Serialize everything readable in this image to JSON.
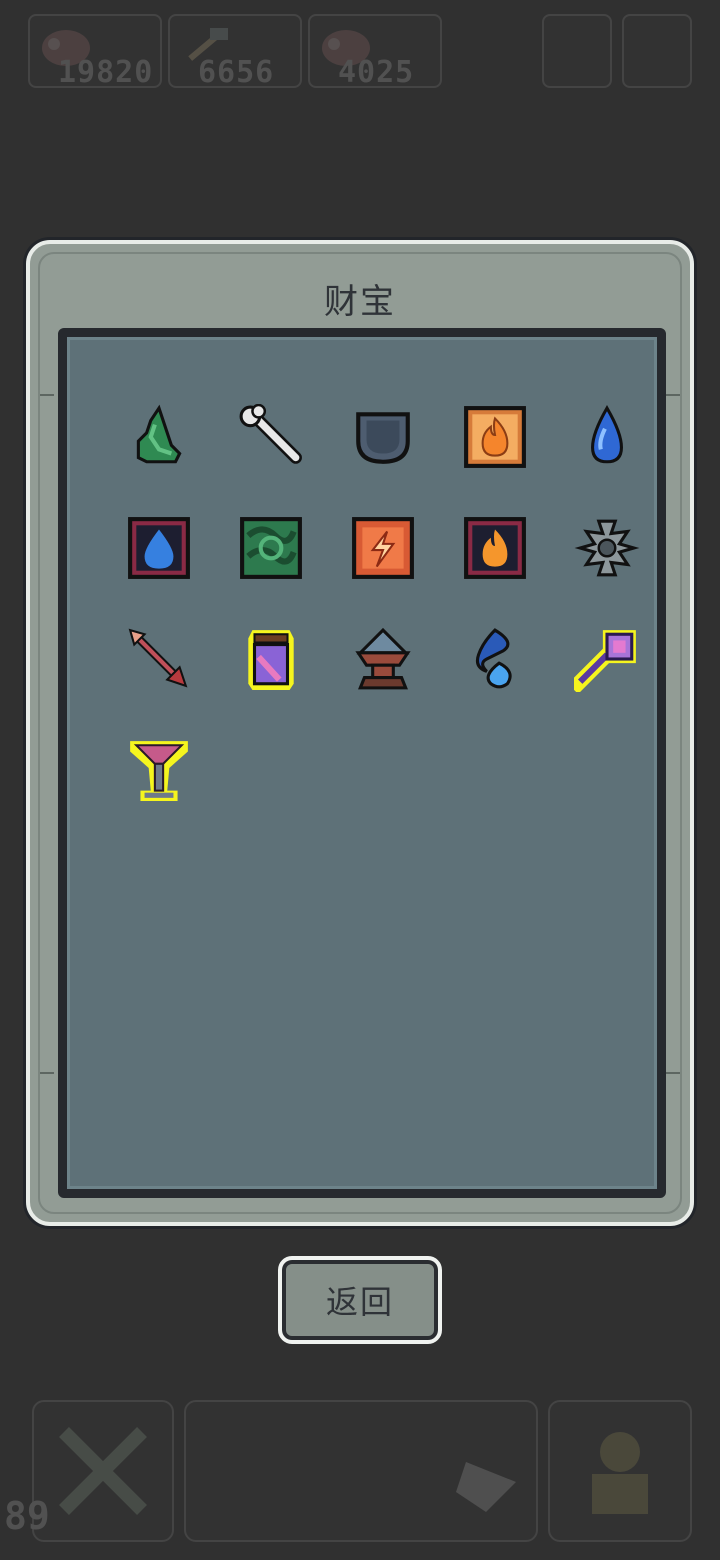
{
  "hud": {
    "resources": [
      {
        "icon": "meat-icon",
        "value": "19820"
      },
      {
        "icon": "hammer-icon",
        "value": "6656"
      },
      {
        "icon": "meat-icon",
        "value": "4025"
      }
    ],
    "level": "89"
  },
  "dialog": {
    "title": "财宝",
    "back_label": "返回",
    "items": [
      {
        "icon": "green-leaf-icon",
        "highlighted": false
      },
      {
        "icon": "bone-icon",
        "highlighted": false
      },
      {
        "icon": "pouch-icon",
        "highlighted": false
      },
      {
        "icon": "fire-tile-icon",
        "highlighted": false
      },
      {
        "icon": "water-drop-icon",
        "highlighted": false
      },
      {
        "icon": "water-tile-icon",
        "highlighted": false
      },
      {
        "icon": "leaf-tile-icon",
        "highlighted": false
      },
      {
        "icon": "lightning-tile-icon",
        "highlighted": false
      },
      {
        "icon": "fire-tile-icon",
        "highlighted": false
      },
      {
        "icon": "gear-ring-icon",
        "highlighted": false
      },
      {
        "icon": "arrow-icon",
        "highlighted": false
      },
      {
        "icon": "potion-jar-icon",
        "highlighted": true
      },
      {
        "icon": "anvil-icon",
        "highlighted": false
      },
      {
        "icon": "blue-flame-icon",
        "highlighted": false
      },
      {
        "icon": "magic-staff-icon",
        "highlighted": true
      },
      {
        "icon": "chalice-icon",
        "highlighted": true
      }
    ]
  },
  "colors": {
    "background": "#303030",
    "panel": "#929c95",
    "grid_bg": "#5e7178",
    "highlight": "#f5f51e"
  }
}
